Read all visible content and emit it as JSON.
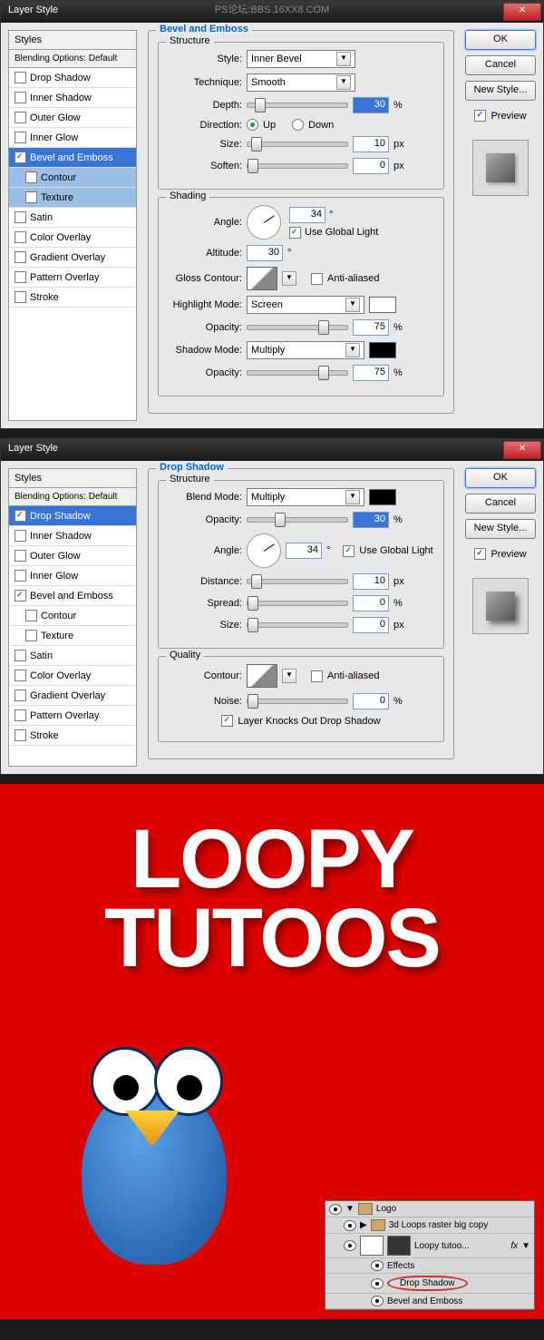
{
  "watermark": "PS论坛:BBS.16XX8.COM",
  "dialog1": {
    "title": "Layer Style",
    "styles_header": "Styles",
    "blending_options": "Blending Options: Default",
    "items": [
      {
        "label": "Drop Shadow",
        "checked": false
      },
      {
        "label": "Inner Shadow",
        "checked": false
      },
      {
        "label": "Outer Glow",
        "checked": false
      },
      {
        "label": "Inner Glow",
        "checked": false
      },
      {
        "label": "Bevel and Emboss",
        "checked": true,
        "selected": true
      },
      {
        "label": "Contour",
        "checked": false,
        "sub": true
      },
      {
        "label": "Texture",
        "checked": false,
        "sub": true
      },
      {
        "label": "Satin",
        "checked": false
      },
      {
        "label": "Color Overlay",
        "checked": false
      },
      {
        "label": "Gradient Overlay",
        "checked": false
      },
      {
        "label": "Pattern Overlay",
        "checked": false
      },
      {
        "label": "Stroke",
        "checked": false
      }
    ],
    "section_title": "Bevel and Emboss",
    "structure": "Structure",
    "style_lbl": "Style:",
    "style_val": "Inner Bevel",
    "technique_lbl": "Technique:",
    "technique_val": "Smooth",
    "depth_lbl": "Depth:",
    "depth_val": "30",
    "depth_unit": "%",
    "direction_lbl": "Direction:",
    "up": "Up",
    "down": "Down",
    "size_lbl": "Size:",
    "size_val": "10",
    "size_unit": "px",
    "soften_lbl": "Soften:",
    "soften_val": "0",
    "soften_unit": "px",
    "shading": "Shading",
    "angle_lbl": "Angle:",
    "angle_val": "34",
    "angle_unit": "°",
    "global_light": "Use Global Light",
    "altitude_lbl": "Altitude:",
    "altitude_val": "30",
    "altitude_unit": "°",
    "gloss_lbl": "Gloss Contour:",
    "antialiased": "Anti-aliased",
    "highlight_lbl": "Highlight Mode:",
    "highlight_val": "Screen",
    "opacity_lbl": "Opacity:",
    "h_opacity": "75",
    "shadow_lbl": "Shadow Mode:",
    "shadow_val": "Multiply",
    "s_opacity": "75",
    "pct": "%"
  },
  "dialog2": {
    "title": "Layer Style",
    "styles_header": "Styles",
    "blending_options": "Blending Options: Default",
    "items": [
      {
        "label": "Drop Shadow",
        "checked": true,
        "selected": true
      },
      {
        "label": "Inner Shadow",
        "checked": false
      },
      {
        "label": "Outer Glow",
        "checked": false
      },
      {
        "label": "Inner Glow",
        "checked": false
      },
      {
        "label": "Bevel and Emboss",
        "checked": true
      },
      {
        "label": "Contour",
        "checked": false,
        "sub": true
      },
      {
        "label": "Texture",
        "checked": false,
        "sub": true
      },
      {
        "label": "Satin",
        "checked": false
      },
      {
        "label": "Color Overlay",
        "checked": false
      },
      {
        "label": "Gradient Overlay",
        "checked": false
      },
      {
        "label": "Pattern Overlay",
        "checked": false
      },
      {
        "label": "Stroke",
        "checked": false
      }
    ],
    "section_title": "Drop Shadow",
    "structure": "Structure",
    "blend_lbl": "Blend Mode:",
    "blend_val": "Multiply",
    "opacity_lbl": "Opacity:",
    "opacity_val": "30",
    "pct": "%",
    "angle_lbl": "Angle:",
    "angle_val": "34",
    "angle_unit": "°",
    "global_light": "Use Global Light",
    "distance_lbl": "Distance:",
    "distance_val": "10",
    "px": "px",
    "spread_lbl": "Spread:",
    "spread_val": "0",
    "size_lbl": "Size:",
    "size_val": "0",
    "quality": "Quality",
    "contour_lbl": "Contour:",
    "antialiased": "Anti-aliased",
    "noise_lbl": "Noise:",
    "noise_val": "0",
    "knocks_out": "Layer Knocks Out Drop Shadow"
  },
  "buttons": {
    "ok": "OK",
    "cancel": "Cancel",
    "new_style": "New Style...",
    "preview": "Preview"
  },
  "result": {
    "line1": "LOOPY",
    "line2": "TUTOOS"
  },
  "layers": {
    "logo": "Logo",
    "loops": "3d Loops  raster  big copy",
    "tutoo": "Loopy tutoo...",
    "effects": "Effects",
    "drop_shadow": "Drop Shadow",
    "bevel": "Bevel and Emboss",
    "fx": "fx"
  }
}
